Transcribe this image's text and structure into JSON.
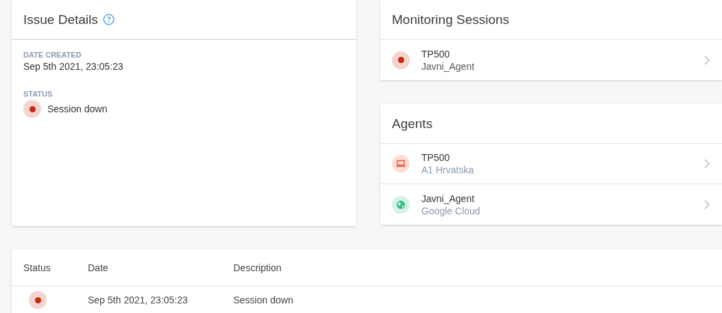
{
  "issue_details": {
    "title": "Issue Details",
    "fields": [
      {
        "label": "DATE CREATED",
        "value": "Sep 5th 2021, 23:05:23",
        "kind": "text"
      },
      {
        "label": "STATUS",
        "value": "Session down",
        "kind": "status",
        "color": "#c62a0f"
      }
    ]
  },
  "monitoring_sessions": {
    "title": "Monitoring Sessions",
    "items": [
      {
        "name": "TP500",
        "subtitle": "Javni_Agent",
        "kind": "status",
        "color": "#c62a0f"
      }
    ]
  },
  "agents": {
    "title": "Agents",
    "items": [
      {
        "name": "TP500",
        "subtitle": "A1 Hrvatska",
        "kind": "laptop",
        "color": "#f0563a"
      },
      {
        "name": "Javni_Agent",
        "subtitle": "Google Cloud",
        "kind": "globe",
        "color": "#2fbf80"
      }
    ]
  },
  "events_table": {
    "columns": [
      "Status",
      "Date",
      "Description"
    ],
    "rows": [
      {
        "color": "#c62a0f",
        "date": "Sep 5th 2021, 23:05:23",
        "description": "Session down"
      }
    ]
  }
}
